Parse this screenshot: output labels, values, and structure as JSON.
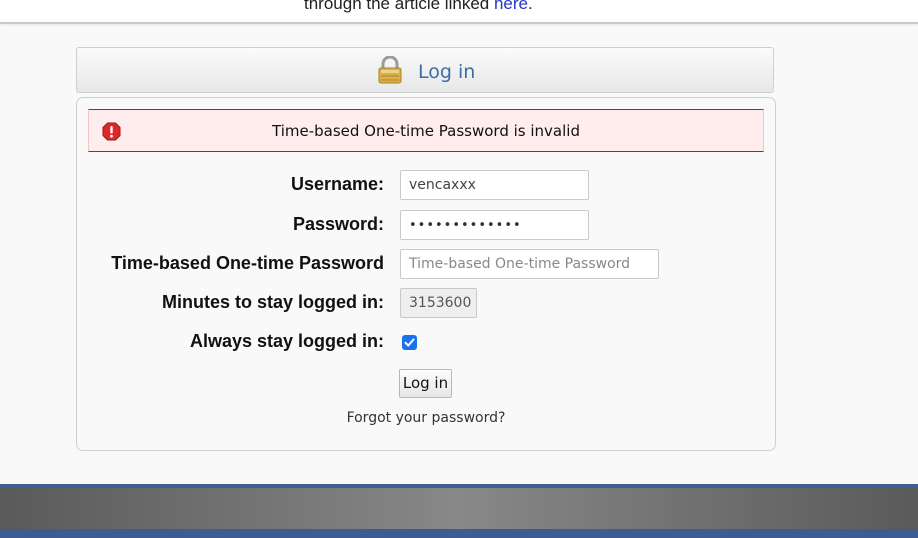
{
  "top_notice": {
    "text": "through the article linked ",
    "link_label": "here",
    "suffix": "."
  },
  "header": {
    "title": "Log in",
    "icon": "lock-icon"
  },
  "error": {
    "icon": "error-icon",
    "message": "Time-based One-time Password is invalid"
  },
  "form": {
    "username_label": "Username:",
    "username_value": "vencaxxx",
    "password_label": "Password:",
    "password_value": "•••••••••••••",
    "totp_label": "Time-based One-time Password",
    "totp_placeholder": "Time-based One-time Password",
    "minutes_label": "Minutes to stay logged in:",
    "minutes_value": "3153600",
    "always_label": "Always stay logged in:",
    "always_checked": true,
    "submit_label": "Log in",
    "forgot_label": "Forgot your password?"
  },
  "colors": {
    "title": "#3c6ea3",
    "error_bg": "#ffecec",
    "error_border": "#8b2e2e",
    "checkbox": "#1a73e8",
    "footer_accent": "#3d5c8f"
  }
}
